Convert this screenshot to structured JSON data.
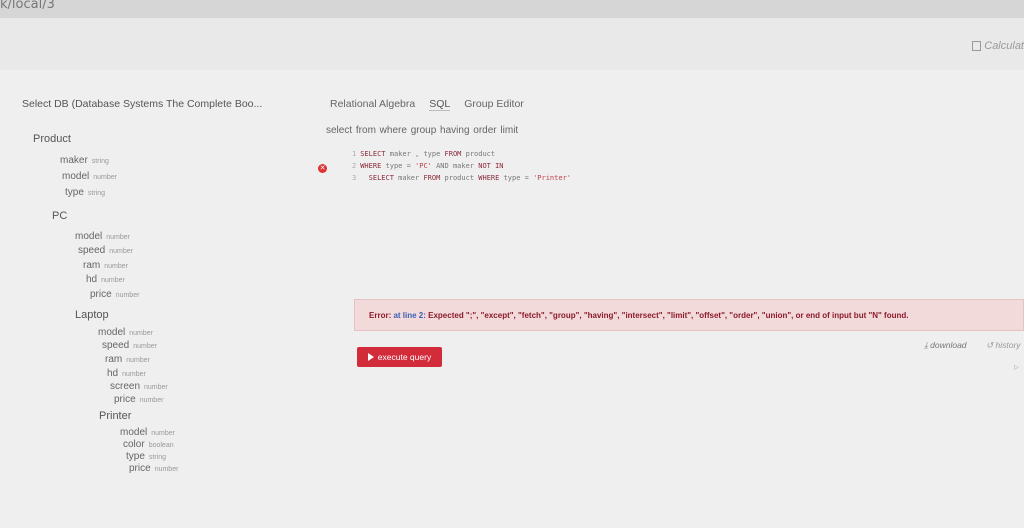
{
  "url": "k/local/3",
  "calculator_label": "Calculat",
  "db_select": "Select DB (Database Systems The Complete Boo...",
  "tabs": [
    "Relational Algebra",
    "SQL",
    "Group Editor"
  ],
  "keywords": "select  from  where  group  having  order  limit",
  "tables": [
    {
      "name": "Product",
      "columns": [
        {
          "name": "maker",
          "type": "string"
        },
        {
          "name": "model",
          "type": "number"
        },
        {
          "name": "type",
          "type": "string"
        }
      ]
    },
    {
      "name": "PC",
      "columns": [
        {
          "name": "model",
          "type": "number"
        },
        {
          "name": "speed",
          "type": "number"
        },
        {
          "name": "ram",
          "type": "number"
        },
        {
          "name": "hd",
          "type": "number"
        },
        {
          "name": "price",
          "type": "number"
        }
      ]
    },
    {
      "name": "Laptop",
      "columns": [
        {
          "name": "model",
          "type": "number"
        },
        {
          "name": "speed",
          "type": "number"
        },
        {
          "name": "ram",
          "type": "number"
        },
        {
          "name": "hd",
          "type": "number"
        },
        {
          "name": "screen",
          "type": "number"
        },
        {
          "name": "price",
          "type": "number"
        }
      ]
    },
    {
      "name": "Printer",
      "columns": [
        {
          "name": "model",
          "type": "number"
        },
        {
          "name": "color",
          "type": "boolean"
        },
        {
          "name": "type",
          "type": "string"
        },
        {
          "name": "price",
          "type": "number"
        }
      ]
    }
  ],
  "code": {
    "line1": {
      "n": "1",
      "a": "SELECT",
      "b": " maker , type ",
      "c": "FROM",
      "d": " product"
    },
    "line2": {
      "n": "2",
      "a": "WHERE",
      "b": " type = ",
      "c": "'PC'",
      "d": " AND maker ",
      "e": "NOT IN"
    },
    "line3": {
      "n": "3",
      "a": "SELECT",
      "b": " maker ",
      "c": "FROM",
      "d": " product ",
      "e": "WHERE",
      "f": " type = ",
      "g": "'Printer'"
    }
  },
  "error": {
    "prefix": "Error: ",
    "location": "at line 2:",
    "message": " Expected \";\", \"except\", \"fetch\", \"group\", \"having\", \"intersect\", \"limit\", \"offset\", \"order\", \"union\", or end of input but \"N\" found."
  },
  "execute_label": "execute query",
  "download_label": "download",
  "history_label": "history",
  "colors": {
    "accent_button": "#d22b3a",
    "error_bg": "#f2d9da",
    "error_text": "#8b1b2b"
  }
}
